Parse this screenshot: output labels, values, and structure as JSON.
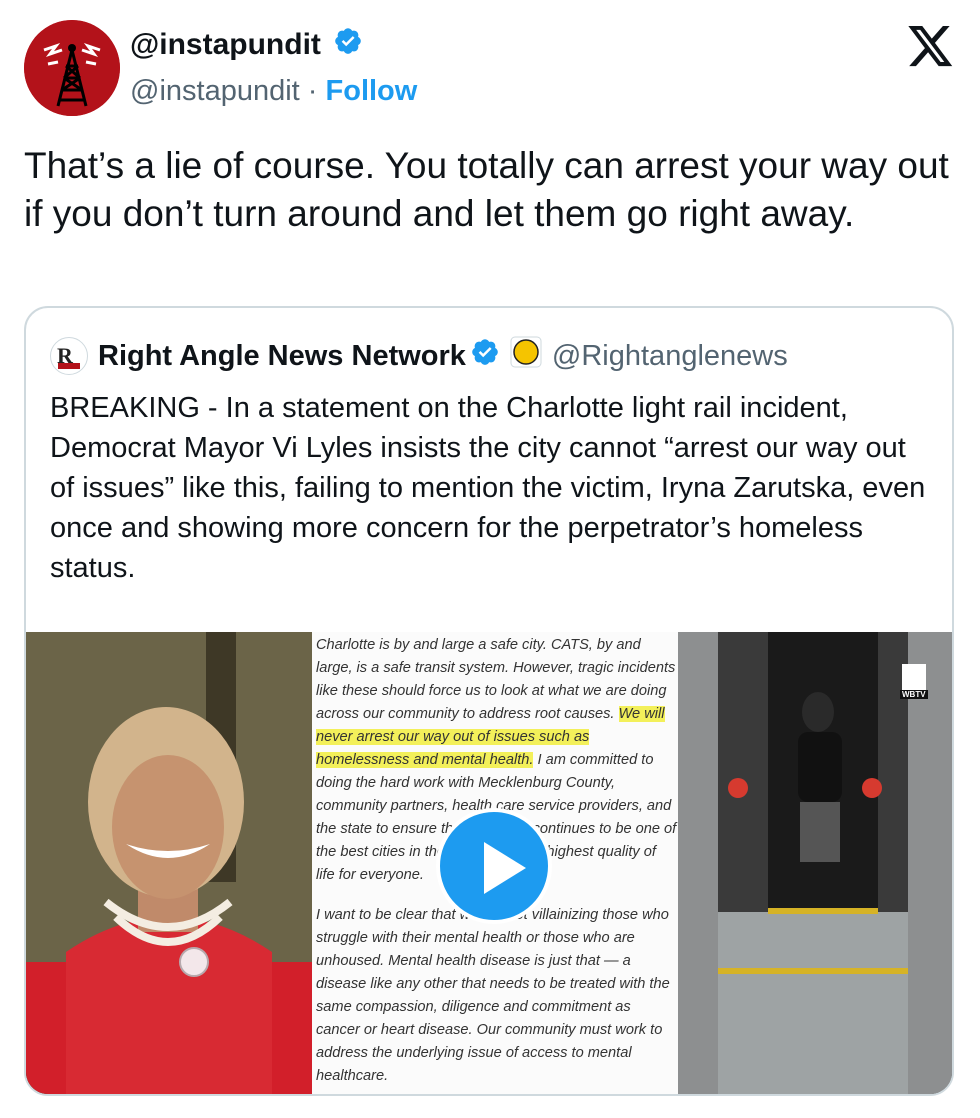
{
  "author": {
    "display_name": "@instapundit",
    "handle": "@instapundit",
    "separator": "·",
    "follow_label": "Follow"
  },
  "tweet": {
    "text": "That’s a lie of course. You totally can arrest your way out if you don’t turn around and let them go right away."
  },
  "quoted": {
    "display_name": "Right Angle News Network",
    "handle": "@Rightanglenews",
    "text": "BREAKING - In a statement on the Charlotte light rail incident, Democrat Mayor Vi Lyles insists the city cannot “arrest our way out of issues” like this, failing to mention the victim, Iryna Zarutska, even once and showing more concern for the perpetrator’s homeless status."
  },
  "media": {
    "doc_p1_before": "Charlotte is by and large a safe city. CATS, by and large, is a safe transit system. However, tragic incidents like these should force us to look at what we are doing across our community to address root causes. ",
    "doc_p1_highlight": "We will never arrest our way out of issues such as homelessness and mental health.",
    "doc_p1_after": " I am committed to doing the hard work with Mecklenburg County, community partners, health care service providers, and the state to ensure that Charlotte continues to be one of the best cities in the world, with the highest quality of life for everyone.",
    "doc_p2": "I want to be clear that we are not villainizing those who struggle with their mental health or those who are unhoused. Mental health disease is just that — a disease like any other that needs to be treated with the same compassion, diligence and commitment as cancer or heart disease. Our community must work to address the underlying issue of access to mental healthcare.",
    "station_logo": "WBTV"
  },
  "colors": {
    "accent": "#1d9bf0",
    "avatar_bg": "#b3121a",
    "highlight": "#f3f05a"
  },
  "icons": [
    "verified-badge-icon",
    "x-logo-icon",
    "play-icon"
  ]
}
